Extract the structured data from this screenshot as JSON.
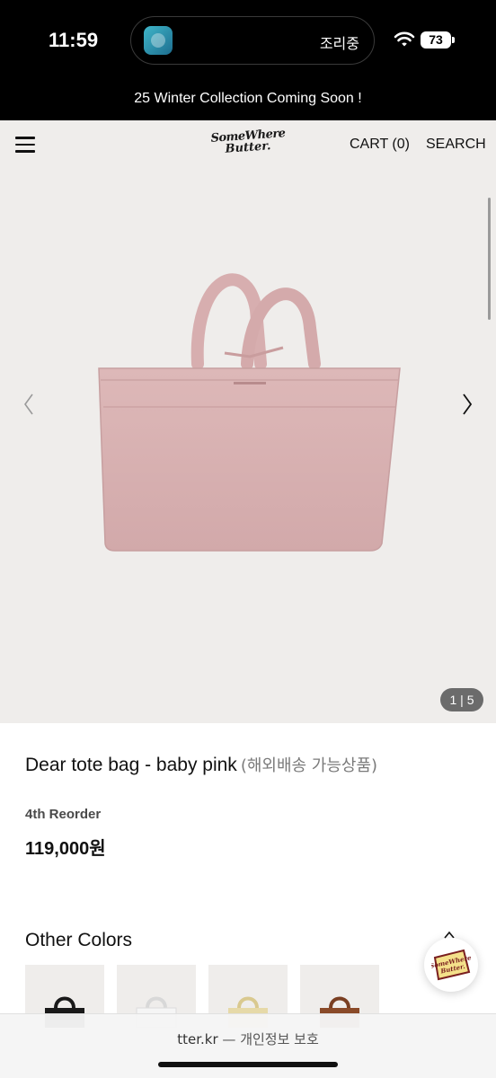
{
  "status_bar": {
    "time": "11:59",
    "island_label": "조리중",
    "battery": "73"
  },
  "announcement": "25 Winter Collection Coming Soon !",
  "header": {
    "logo_line1": "SomeWhere",
    "logo_line2": "Butter.",
    "cart": "CART (0)",
    "search": "SEARCH"
  },
  "gallery": {
    "counter": "1 | 5"
  },
  "product": {
    "title": "Dear tote bag - baby pink",
    "subtitle": "(해외배송 가능상품)",
    "reorder": "4th Reorder",
    "price": "119,000원"
  },
  "other_colors": {
    "heading": "Other Colors",
    "swatches": [
      {
        "name": "black",
        "color": "#1a1a1a"
      },
      {
        "name": "white",
        "color": "#f2f2f2"
      },
      {
        "name": "butter",
        "color": "#e6d9a8"
      },
      {
        "name": "brown",
        "color": "#8a4a28"
      }
    ]
  },
  "badge": {
    "line1": "SomeWhere",
    "line2": "Butter."
  },
  "browser": {
    "url": "tter.kr",
    "separator": " — ",
    "privacy": "개인정보 보호"
  },
  "colors": {
    "bag_pink": "#d9b1b1",
    "background": "#efedeb"
  }
}
